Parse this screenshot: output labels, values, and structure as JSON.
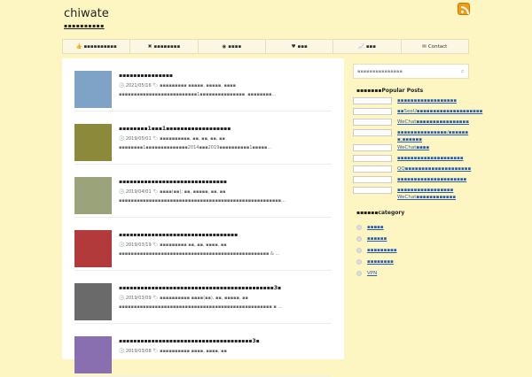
{
  "site": {
    "title": "chiwate",
    "description": "▪▪▪▪▪▪▪▪▪▪"
  },
  "nav": [
    {
      "icon": "thumbs-up-icon",
      "glyph": "👍",
      "label": "▪▪▪▪▪▪▪▪▪▪"
    },
    {
      "icon": "close-icon",
      "glyph": "✖",
      "label": "▪▪▪▪▪▪▪▪"
    },
    {
      "icon": "user-circle-icon",
      "glyph": "◉",
      "label": "▪▪▪▪"
    },
    {
      "icon": "heart-icon",
      "glyph": "♥",
      "label": "▪▪▪"
    },
    {
      "icon": "chart-icon",
      "glyph": "📈",
      "label": "▪▪▪"
    },
    {
      "icon": "envelope-icon",
      "glyph": "✉",
      "label": "Contact"
    }
  ],
  "posts": [
    {
      "title": "▪▪▪▪▪▪▪▪▪▪▪▪▪▪▪",
      "meta": "🕓 2021/05/16 🏷 ▪▪▪▪▪▪▪▪▪ ▪▪▪▪▪, ▪▪▪▪▪, ▪▪▪▪",
      "excerpt": "▪▪▪▪▪▪▪▪▪▪▪▪▪▪▪▪▪▪▪▪▪▪▪▪▪▪1▪▪▪▪▪▪▪▪▪▪▪▪▪▪▪. ▪▪▪▪▪▪▪▪...",
      "thumb_color": "#7fa3c7"
    },
    {
      "title": "▪▪▪▪▪▪▪▪1▪▪▪1▪▪▪▪▪▪▪▪▪▪▪▪▪▪▪▪▪▪",
      "meta": "🕓 2019/05/01 🏷 ▪▪▪▪▪▪▪▪▪▪, ▪▪, ▪▪, ▪▪, ▪▪",
      "excerpt": "▪▪▪▪▪▪▪▪1▪▪▪▪▪▪▪▪▪▪▪▪▪▪2014▪▪▪2019▪▪▪▪▪▪▪▪▪▪1▪▪▪▪▪...",
      "thumb_color": "#8c8a3a"
    },
    {
      "title": "▪▪▪▪▪▪▪▪▪▪▪▪▪▪▪▪▪▪▪▪▪▪▪▪▪▪▪▪▪▪",
      "meta": "🕓 2019/04/01 🏷 ▪▪▪▪(▪▪); ▪▪, ▪▪▪▪▪, ▪▪, ▪▪",
      "excerpt": "▪▪▪▪▪▪▪▪▪▪▪▪▪▪▪▪▪▪▪▪▪▪▪▪▪▪▪▪▪▪▪▪▪▪▪▪▪▪▪▪▪▪▪▪▪▪▪▪▪▪▪▪▪▪...",
      "thumb_color": "#9aa37a"
    },
    {
      "title": "▪▪▪▪▪▪▪▪▪▪▪▪▪▪▪▪▪▪▪▪▪▪▪▪▪▪▪▪▪▪▪▪▪",
      "meta": "🕓 2019/03/19 🏷 ▪▪▪▪▪▪▪▪▪ ▪▪, ▪▪, ▪▪▪▪, ▪▪",
      "excerpt": "▪▪▪▪▪▪▪▪▪▪▪▪▪▪▪▪▪▪▪▪▪▪▪▪▪▪▪▪▪▪▪▪▪▪▪▪▪▪▪▪▪▪▪▪▪▪▪▪▪▪ & ...",
      "thumb_color": "#b23a3a"
    },
    {
      "title": "▪▪▪▪▪▪▪▪▪▪▪▪▪▪▪▪▪▪▪▪▪▪▪▪▪▪▪▪▪▪▪▪▪▪▪▪▪▪▪▪▪▪▪3▪",
      "meta": "🕓 2019/03/09 🏷 ▪▪▪▪▪▪▪▪▪▪ ▪▪▪▪(▪▪), ▪▪, ▪▪▪▪▪, ▪▪",
      "excerpt": "▪▪▪▪▪▪▪▪▪▪▪▪▪▪▪▪▪▪▪▪▪▪▪▪▪▪▪▪▪▪▪▪▪▪▪▪▪▪▪▪▪▪▪▪▪▪▪▪▪▪▪ ▪ ...",
      "thumb_color": "#6a6a6a"
    },
    {
      "title": "▪▪▪▪▪▪▪▪▪▪▪▪▪▪▪▪▪▪▪▪▪▪▪▪▪▪▪▪▪▪▪▪▪▪▪▪▪3▪",
      "meta": "🕓 2019/03/08 🏷 ▪▪▪▪▪▪▪▪▪▪ ▪▪▪▪, ▪▪▪▪, ▪▪",
      "excerpt": "",
      "thumb_color": "#8a6fb0"
    }
  ],
  "sidebar": {
    "search_placeholder": "▪▪▪▪▪▪▪▪▪▪▪▪▪▪▪",
    "popular_title": "▪▪▪▪▪▪▪Popular Posts",
    "popular": [
      "▪▪▪▪▪▪▪▪▪▪▪▪▪▪▪▪▪▪",
      "▪▪SeeU▪▪▪▪▪▪▪▪▪▪▪▪▪▪▪▪▪▪▪▪",
      "WeChat▪▪▪▪▪▪▪▪▪▪▪▪▪▪▪▪",
      "▪▪▪▪▪▪▪▪▪▪▪▪▪▪▪/▪▪▪▪▪▪ ▪;▪▪▪▪▪▪",
      "WeChat▪▪▪▪",
      "▪▪▪▪▪▪▪▪▪▪▪▪▪▪▪▪▪▪▪▪",
      "QQ▪▪▪▪▪▪▪▪▪▪▪▪▪▪▪▪▪▪▪▪",
      "▪▪▪▪▪▪▪▪▪▪▪▪▪▪▪▪▪▪▪▪▪",
      "▪▪▪▪▪▪▪▪▪▪▪▪▪▪▪▪▪ WeChat▪▪▪▪▪▪▪▪▪▪▪▪"
    ],
    "category_title": "▪▪▪▪▪▪category",
    "categories": [
      "▪▪▪▪▪",
      "▪▪▪▪▪▪",
      "▪▪▪▪▪▪▪▪▪",
      "▪▪▪▪▪▪▪▪",
      "VPN"
    ]
  }
}
